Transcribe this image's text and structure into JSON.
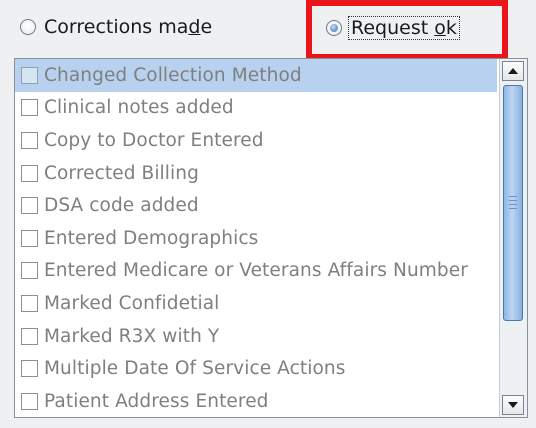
{
  "radios": {
    "corrections_made": {
      "label_pre": "Corrections ma",
      "label_mnemonic": "d",
      "label_post": "e",
      "selected": false
    },
    "request_ok": {
      "label_pre": "Request ",
      "label_mnemonic": "o",
      "label_post": "k",
      "selected": true
    }
  },
  "highlight_color": "#e8151b",
  "list": {
    "items": [
      {
        "label": "Changed Collection Method",
        "checked": false,
        "selected": true
      },
      {
        "label": "Clinical notes added",
        "checked": false,
        "selected": false
      },
      {
        "label": "Copy to Doctor Entered",
        "checked": false,
        "selected": false
      },
      {
        "label": "Corrected Billing",
        "checked": false,
        "selected": false
      },
      {
        "label": "DSA code added",
        "checked": false,
        "selected": false
      },
      {
        "label": "Entered Demographics",
        "checked": false,
        "selected": false
      },
      {
        "label": "Entered Medicare or Veterans Affairs Number",
        "checked": false,
        "selected": false
      },
      {
        "label": "Marked Confidetial",
        "checked": false,
        "selected": false
      },
      {
        "label": "Marked R3X with Y",
        "checked": false,
        "selected": false
      },
      {
        "label": "Multiple Date Of Service Actions",
        "checked": false,
        "selected": false
      },
      {
        "label": "Patient Address Entered",
        "checked": false,
        "selected": false
      }
    ]
  },
  "scrollbar": {
    "up_icon": "arrow-up-icon",
    "down_icon": "arrow-down-icon"
  },
  "colors": {
    "selected_row": "#b8d1ee",
    "item_text_disabled": "#7f7f7f",
    "thumb": "#9bbfe9"
  }
}
